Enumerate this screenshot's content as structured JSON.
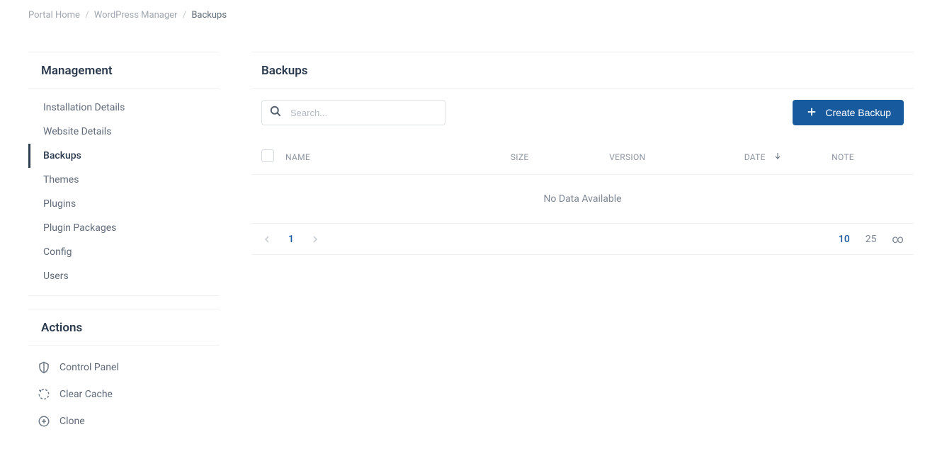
{
  "breadcrumb": {
    "home": "Portal Home",
    "manager": "WordPress Manager",
    "current": "Backups"
  },
  "sidebar": {
    "management_title": "Management",
    "actions_title": "Actions",
    "items": [
      {
        "label": "Installation Details"
      },
      {
        "label": "Website Details"
      },
      {
        "label": "Backups"
      },
      {
        "label": "Themes"
      },
      {
        "label": "Plugins"
      },
      {
        "label": "Plugin Packages"
      },
      {
        "label": "Config"
      },
      {
        "label": "Users"
      }
    ],
    "actions": [
      {
        "label": "Control Panel"
      },
      {
        "label": "Clear Cache"
      },
      {
        "label": "Clone"
      }
    ]
  },
  "page": {
    "title": "Backups"
  },
  "toolbar": {
    "search_placeholder": "Search...",
    "create_label": "Create Backup"
  },
  "table": {
    "headers": {
      "name": "NAME",
      "size": "SIZE",
      "version": "VERSION",
      "date": "DATE",
      "note": "NOTE"
    },
    "empty": "No Data Available"
  },
  "pagination": {
    "current_page": "1",
    "per_page": {
      "opt1": "10",
      "opt2": "25",
      "opt3": "∞"
    }
  }
}
